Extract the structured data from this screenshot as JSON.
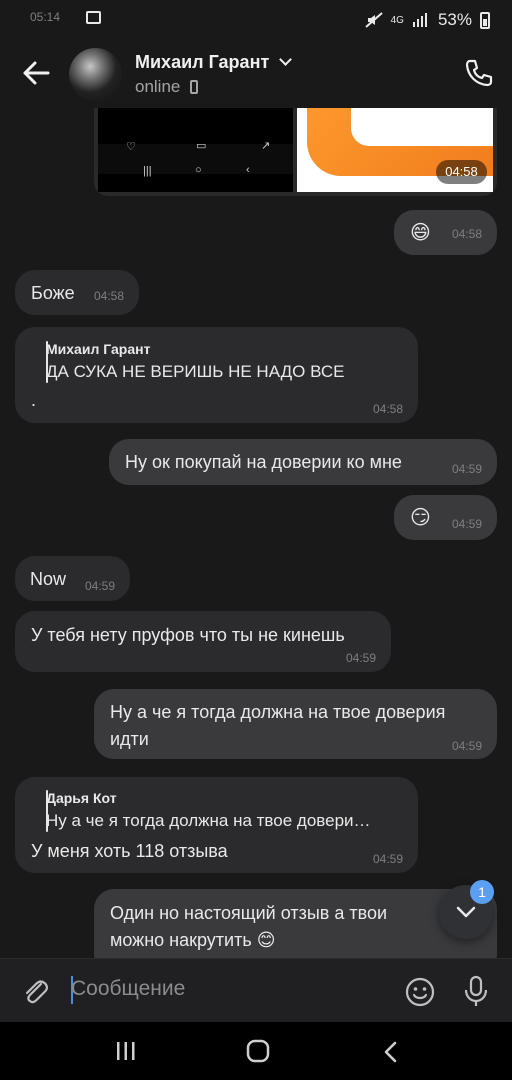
{
  "status_bar": {
    "time": "05:14",
    "network": "4G",
    "battery": "53%"
  },
  "header": {
    "contact_name": "Михаил Гарант",
    "status": "online"
  },
  "photo_message": {
    "time": "04:58"
  },
  "messages": [
    {
      "direction": "out",
      "emoji": "😄",
      "time": "04:58"
    },
    {
      "direction": "in",
      "text": "Боже",
      "time": "04:58"
    },
    {
      "direction": "in",
      "quote_author": "Михаил Гарант",
      "quote_text": "ДА СУКА НЕ ВЕРИШЬ НЕ НАДО ВСЕ",
      "text": ".",
      "time": "04:58"
    },
    {
      "direction": "out",
      "text": "Ну ок покупай на доверии ко мне",
      "time": "04:59"
    },
    {
      "direction": "out",
      "emoji": "😏",
      "time": "04:59"
    },
    {
      "direction": "in",
      "text": "Now",
      "time": "04:59"
    },
    {
      "direction": "in",
      "text": "У тебя нету пруфов что ты не кинешь",
      "time": "04:59"
    },
    {
      "direction": "out",
      "line1": "Ну а че я тогда должна на твое доверия",
      "line2": "идти",
      "time": "04:59"
    },
    {
      "direction": "in",
      "quote_author": "Дарья Кот",
      "quote_text": "Ну а че я тогда должна на твое довери…",
      "text": "У меня хоть 118 отзыва",
      "time": "04:59"
    },
    {
      "direction": "out",
      "line1": "Один но настоящий отзыв а твои",
      "line2": "можно накрутить 😊"
    }
  ],
  "scroll_button": {
    "unread_count": "1"
  },
  "composer": {
    "placeholder": "Сообщение"
  },
  "colors": {
    "background": "#19191a",
    "incoming_bubble": "#2b2b2d",
    "outgoing_bubble": "#3a3a3d",
    "accent": "#5b9ff2"
  }
}
